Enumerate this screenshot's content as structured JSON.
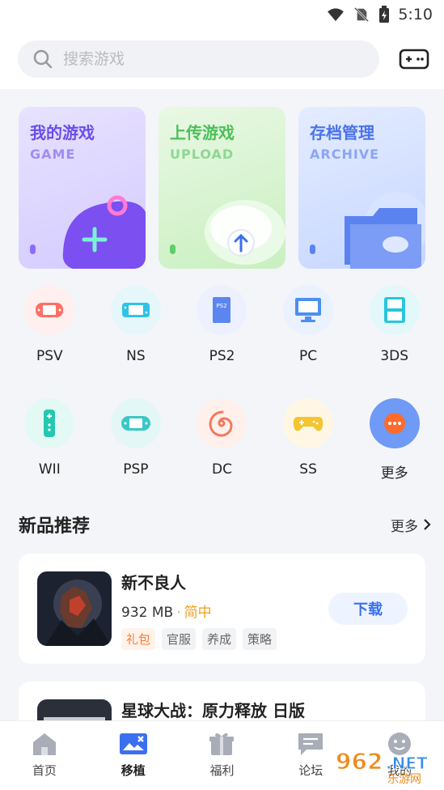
{
  "status": {
    "time": "5:10"
  },
  "search": {
    "placeholder": "搜索游戏"
  },
  "cards": [
    {
      "title": "我的游戏",
      "subtitle": "GAME"
    },
    {
      "title": "上传游戏",
      "subtitle": "UPLOAD"
    },
    {
      "title": "存档管理",
      "subtitle": "ARCHIVE"
    }
  ],
  "platforms": [
    {
      "label": "PSV"
    },
    {
      "label": "NS"
    },
    {
      "label": "PS2"
    },
    {
      "label": "PC"
    },
    {
      "label": "3DS"
    },
    {
      "label": "WII"
    },
    {
      "label": "PSP"
    },
    {
      "label": "DC"
    },
    {
      "label": "SS"
    },
    {
      "label": "更多"
    }
  ],
  "section": {
    "title": "新品推荐",
    "more": "更多"
  },
  "games": [
    {
      "name": "新不良人",
      "size": "932 MB",
      "lang": "简中",
      "tags": [
        "礼包",
        "官服",
        "养成",
        "策略"
      ],
      "button": "下载"
    },
    {
      "name": "星球大战：原力释放 日版"
    }
  ],
  "nav": [
    {
      "label": "首页"
    },
    {
      "label": "移植"
    },
    {
      "label": "福利"
    },
    {
      "label": "论坛"
    },
    {
      "label": "我的"
    }
  ],
  "watermark": {
    "text": "962.NET",
    "sub": "乐游网"
  },
  "colors": {
    "accent": "#3a6ff0",
    "lang": "#f0a020",
    "gift": "#ff7a2e"
  }
}
